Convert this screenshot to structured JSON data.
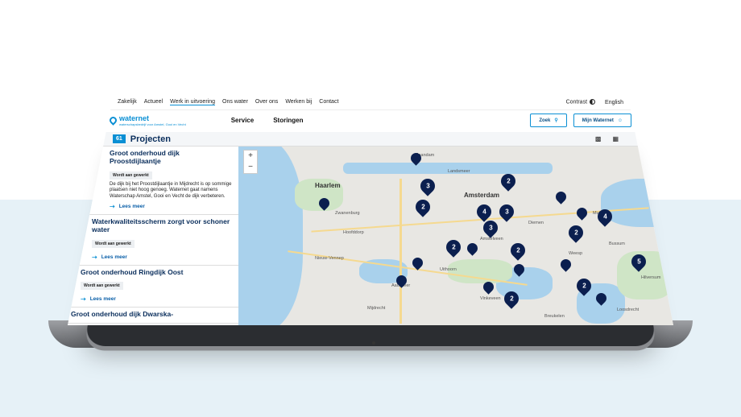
{
  "topbar": {
    "nav": [
      "Zakelijk",
      "Actueel",
      "Werk in uitvoering",
      "Ons water",
      "Over ons",
      "Werken bij",
      "Contact"
    ],
    "active": "Werk in uitvoering",
    "contrast": "Contrast",
    "language": "English"
  },
  "header": {
    "logo": "waternet",
    "logo_sub": "waterschapsbedrijf voor Amstel, Gooi en Vecht",
    "nav": [
      "Service",
      "Storingen"
    ],
    "search_label": "Zoek",
    "account_label": "Mijn Waternet"
  },
  "titlebar": {
    "count": "61",
    "title": "Projecten"
  },
  "projects": [
    {
      "title": "Groot onderhoud dijk Proostdijlaantje",
      "status": "Wordt aan gewerkt",
      "text": "De dijk bij het Proostdijlaantje in Mijdrecht is op sommige plaatsen niet hoog genoeg. Waternet gaat namens Waterschap Amstel, Gooi en Vecht de dijk verbeteren.",
      "more": "Lees meer"
    },
    {
      "title": "Waterkwaliteitsscherm zorgt voor schoner water",
      "status": "Wordt aan gewerkt",
      "text": "",
      "more": "Lees meer"
    },
    {
      "title": "Groot onderhoud Ringdijk Oost",
      "status": "Wordt aan gewerkt",
      "text": "",
      "more": "Lees meer"
    },
    {
      "title": "Groot onderhoud dijk Dwarska-",
      "status": "",
      "text": "",
      "more": ""
    }
  ],
  "map": {
    "places": [
      "Zaandam",
      "Haarlem",
      "Amsterdam",
      "Hoofddorp",
      "Amstelveen",
      "Uithoorn",
      "Hilversum",
      "Muiden",
      "Weesp",
      "Nieuw-Vennep",
      "Aalsmeer",
      "Mijdrecht",
      "Vinkeveen",
      "Loosdrecht",
      "Breukelen",
      "Bussum",
      "Diemen",
      "Landsmeer",
      "Zwanenburg"
    ],
    "markers": [
      "3",
      "2",
      "2",
      "4",
      "3",
      "3",
      "2",
      "4",
      "2",
      "2",
      "5",
      "2",
      "2",
      "",
      "",
      "",
      "",
      "",
      "",
      "",
      "",
      "",
      ""
    ]
  },
  "icons": {
    "search": "search-icon",
    "account": "user-icon",
    "map_view": "map-icon",
    "grid_view": "grid-icon",
    "arrow": "arrow-right-icon"
  },
  "colors": {
    "brand": "#0a8fd4",
    "marker": "#0b1f4f",
    "title": "#0a2e5c"
  }
}
